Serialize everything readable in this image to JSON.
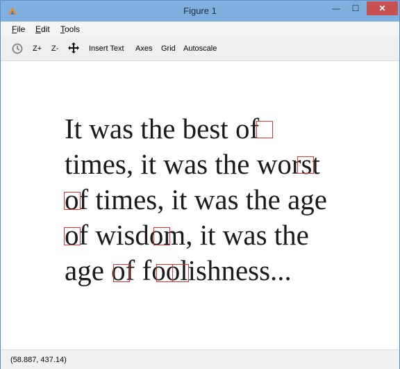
{
  "window": {
    "title": "Figure 1"
  },
  "window_controls": {
    "minimize": "—",
    "maximize": "☐",
    "close": "✕"
  },
  "menubar": [
    {
      "label": "File",
      "mnemonic": "F",
      "rest": "ile"
    },
    {
      "label": "Edit",
      "mnemonic": "E",
      "rest": "dit"
    },
    {
      "label": "Tools",
      "mnemonic": "T",
      "rest": "ools"
    }
  ],
  "toolbar": {
    "reset_icon": "reset-view-icon",
    "zoom_in": "Z+",
    "zoom_out": "Z-",
    "pan_icon": "pan-move-icon",
    "insert_text": "Insert Text",
    "axes": "Axes",
    "grid": "Grid",
    "autoscale": "Autoscale"
  },
  "figure_text": {
    "lines": [
      "It was the best of",
      "times, it was the worst",
      "of times, it was the age",
      "of wisdom, it was the",
      "age of foolishness..."
    ],
    "highlight_color": "#e03030",
    "highlighted_letter": "o"
  },
  "status": {
    "coordinates": "(58.887, 437.14)"
  },
  "colors": {
    "titlebar": "#7fb0e0",
    "close_button": "#c75050"
  }
}
